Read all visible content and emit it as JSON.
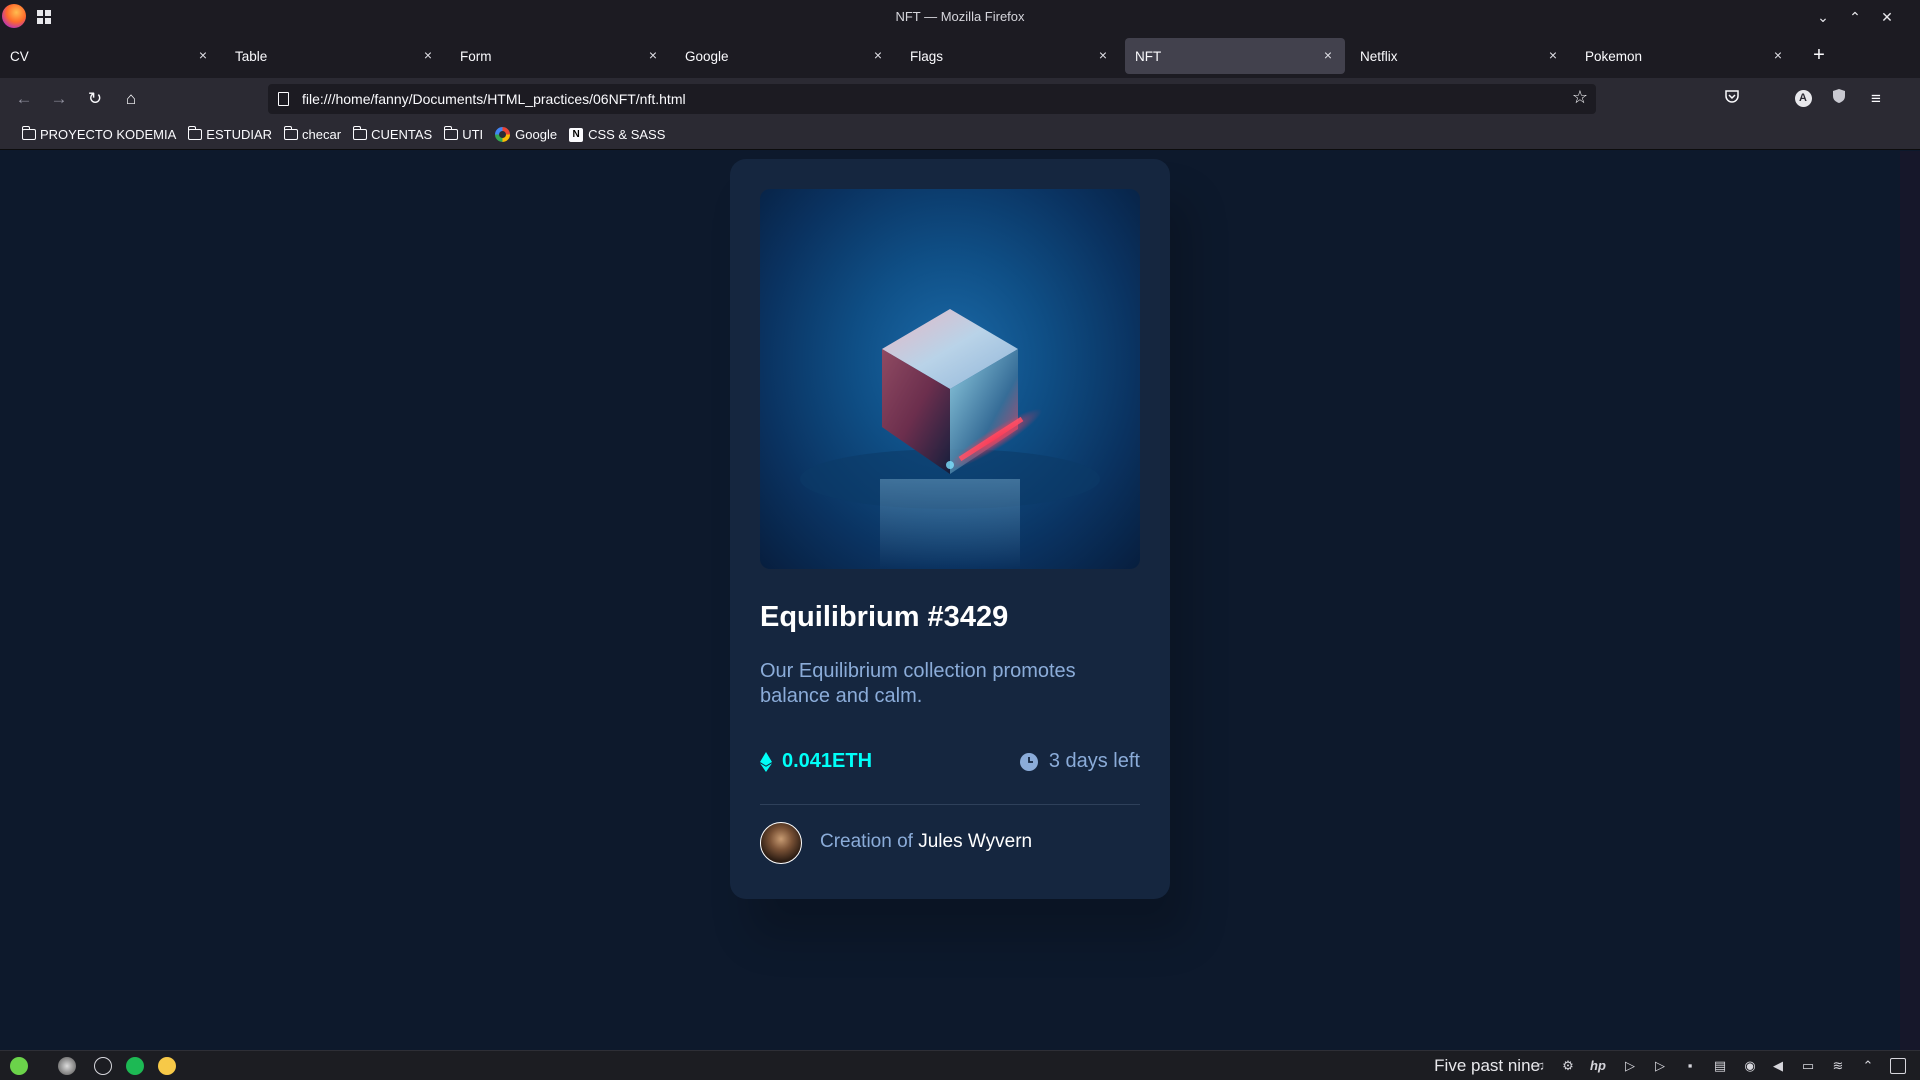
{
  "window": {
    "title": "NFT — Mozilla Firefox"
  },
  "tabs": [
    {
      "label": "CV"
    },
    {
      "label": "Table"
    },
    {
      "label": "Form"
    },
    {
      "label": "Google"
    },
    {
      "label": "Flags"
    },
    {
      "label": "NFT",
      "active": true
    },
    {
      "label": "Netflix"
    },
    {
      "label": "Pokemon"
    }
  ],
  "tab_close_glyph": "×",
  "new_tab_glyph": "+",
  "nav": {
    "url": "file:///home/fanny/Documents/HTML_practices/06NFT/nft.html",
    "profile_initial": "A"
  },
  "bookmarks": [
    {
      "label": "PROYECTO KODEMIA",
      "icon": "folder-icon"
    },
    {
      "label": "ESTUDIAR",
      "icon": "folder-icon"
    },
    {
      "label": "checar",
      "icon": "folder-icon"
    },
    {
      "label": "CUENTAS",
      "icon": "folder-icon"
    },
    {
      "label": "UTI",
      "icon": "folder-icon"
    },
    {
      "label": "Google",
      "icon": "google-icon"
    },
    {
      "label": "CSS & SASS",
      "icon": "notion-icon"
    }
  ],
  "card": {
    "title": "Equilibrium #3429",
    "description": "Our Equilibrium collection promotes balance and calm.",
    "price": "0.041ETH",
    "time_left": "3 days left",
    "creation_prefix": "Creation of",
    "creator": "Jules Wyvern"
  },
  "colors": {
    "page_bg": "#0d192c",
    "card_bg": "#15263f",
    "cyan": "#00fff8",
    "soft_blue": "#8bacd9",
    "line": "#2e405a"
  },
  "taskbar": {
    "clock": "Five past nine"
  }
}
